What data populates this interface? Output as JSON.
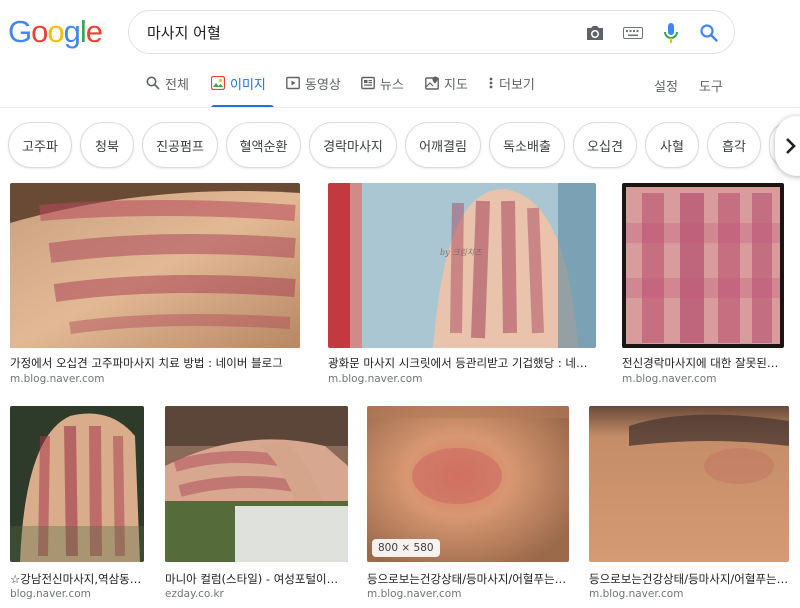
{
  "logo": {
    "letters": [
      "G",
      "o",
      "o",
      "g",
      "l",
      "e"
    ]
  },
  "search": {
    "query": "마사지 어혈"
  },
  "tabs": [
    {
      "label": "전체",
      "icon": "search-icon"
    },
    {
      "label": "이미지",
      "icon": "image-icon",
      "active": true
    },
    {
      "label": "동영상",
      "icon": "play-icon"
    },
    {
      "label": "뉴스",
      "icon": "news-icon"
    },
    {
      "label": "지도",
      "icon": "map-icon"
    },
    {
      "label": "더보기",
      "icon": "more-vert-icon"
    }
  ],
  "right_links": {
    "settings": "설정",
    "tools": "도구"
  },
  "chips": [
    "고주파",
    "청북",
    "진공펌프",
    "혈액순환",
    "경락마사지",
    "어깨결림",
    "독소배출",
    "오십견",
    "사혈",
    "흡각"
  ],
  "results": [
    {
      "title": "가정에서 오십견 고주파마사지 치료 방법 : 네이버 블로그",
      "source": "m.blog.naver.com"
    },
    {
      "title": "광화문 마사지 시크릿에서 등관리받고 기겁했당 : 네이버…",
      "source": "m.blog.naver.com",
      "watermark": "by 크림치즈"
    },
    {
      "title": "전신경락마사지에 대한 잘못된상…",
      "source": "m.blog.naver.com"
    },
    {
      "title": "☆강남전신마사지,역삼동…",
      "source": "blog.naver.com"
    },
    {
      "title": "마니아 컬럼(스타일) - 여성포털이지…",
      "source": "ezday.co.kr"
    },
    {
      "title": "등으로보는건강상태/등마사지/어혈푸는…",
      "source": "m.blog.naver.com",
      "dimensions": "800 × 580"
    },
    {
      "title": "등으로보는건강상태/등마사지/어혈푸는…",
      "source": "m.blog.naver.com"
    }
  ],
  "colors": {
    "accent": "#1a73e8",
    "google_blue": "#4285f4",
    "google_red": "#ea4335",
    "google_yellow": "#fbbc05",
    "google_green": "#34a853"
  }
}
